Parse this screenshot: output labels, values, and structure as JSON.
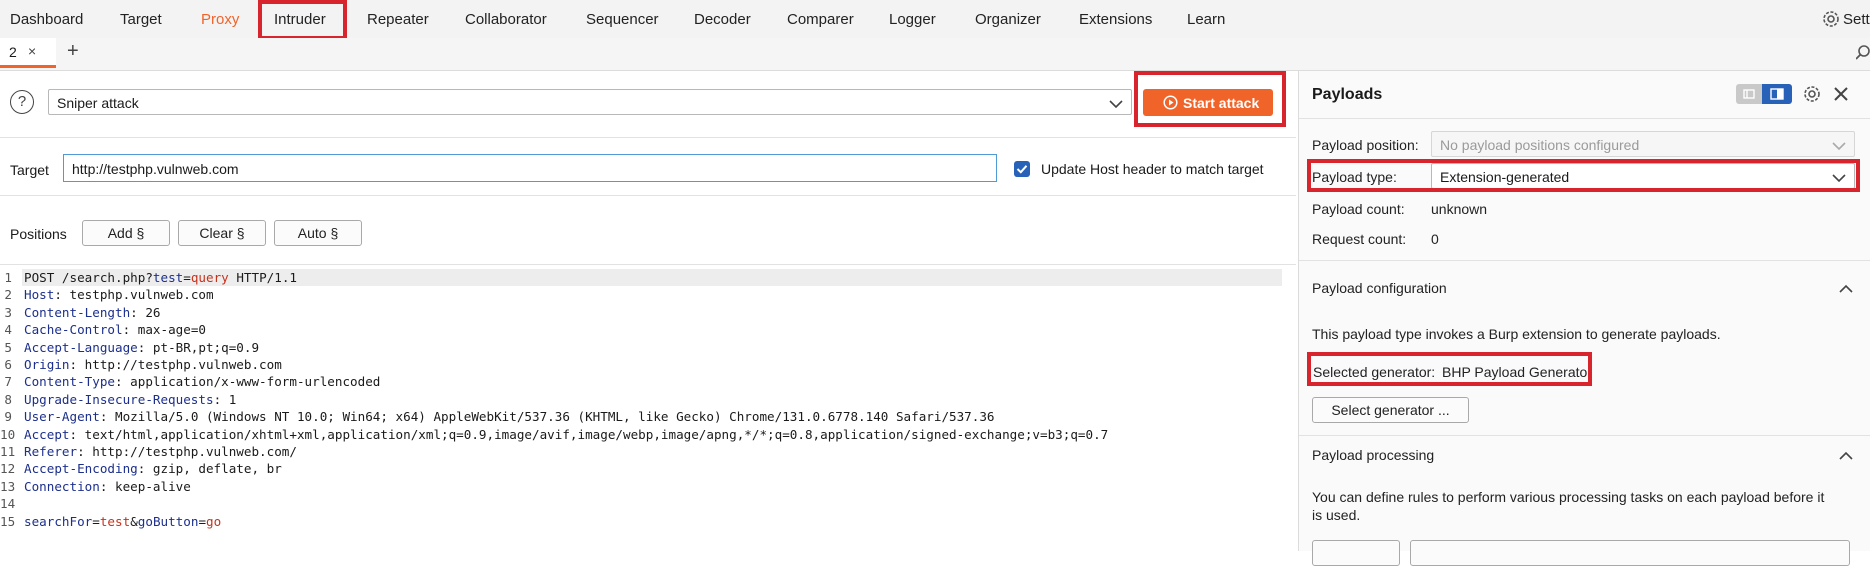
{
  "menu": {
    "items": [
      "Dashboard",
      "Target",
      "Proxy",
      "Intruder",
      "Repeater",
      "Collaborator",
      "Sequencer",
      "Decoder",
      "Comparer",
      "Logger",
      "Organizer",
      "Extensions",
      "Learn"
    ],
    "settings_label": "Setti",
    "active_color": "#f0642a"
  },
  "tabs": {
    "current": "2",
    "close": "×",
    "add": "+"
  },
  "attack": {
    "help": "?",
    "type": "Sniper attack",
    "start_label": "Start attack",
    "start_color": "#f0642a"
  },
  "target": {
    "label": "Target",
    "value": "http://testphp.vulnweb.com",
    "update_host_label": "Update Host header to match target",
    "update_host_checked": true
  },
  "positions": {
    "label": "Positions",
    "buttons": [
      "Add §",
      "Clear §",
      "Auto §"
    ]
  },
  "request": {
    "lines": [
      {
        "n": "1",
        "parts": [
          [
            "v",
            "POST /search.php?"
          ],
          [
            "k",
            "test"
          ],
          [
            "v",
            "="
          ],
          [
            "p",
            "query"
          ],
          [
            "v",
            " HTTP/1.1"
          ]
        ]
      },
      {
        "n": "2",
        "parts": [
          [
            "k",
            "Host"
          ],
          [
            "v",
            ": testphp.vulnweb.com"
          ]
        ]
      },
      {
        "n": "3",
        "parts": [
          [
            "k",
            "Content-Length"
          ],
          [
            "v",
            ": 26"
          ]
        ]
      },
      {
        "n": "4",
        "parts": [
          [
            "k",
            "Cache-Control"
          ],
          [
            "v",
            ": max-age=0"
          ]
        ]
      },
      {
        "n": "5",
        "parts": [
          [
            "k",
            "Accept-Language"
          ],
          [
            "v",
            ": pt-BR,pt;q=0.9"
          ]
        ]
      },
      {
        "n": "6",
        "parts": [
          [
            "k",
            "Origin"
          ],
          [
            "v",
            ": http://testphp.vulnweb.com"
          ]
        ]
      },
      {
        "n": "7",
        "parts": [
          [
            "k",
            "Content-Type"
          ],
          [
            "v",
            ": application/x-www-form-urlencoded"
          ]
        ]
      },
      {
        "n": "8",
        "parts": [
          [
            "k",
            "Upgrade-Insecure-Requests"
          ],
          [
            "v",
            ": 1"
          ]
        ]
      },
      {
        "n": "9",
        "parts": [
          [
            "k",
            "User-Agent"
          ],
          [
            "v",
            ": Mozilla/5.0 (Windows NT 10.0; Win64; x64) AppleWebKit/537.36 (KHTML, like Gecko) Chrome/131.0.6778.140 Safari/537.36"
          ]
        ]
      },
      {
        "n": "10",
        "parts": [
          [
            "k",
            "Accept"
          ],
          [
            "v",
            ": text/html,application/xhtml+xml,application/xml;q=0.9,image/avif,image/webp,image/apng,*/*;q=0.8,application/signed-exchange;v=b3;q=0.7"
          ]
        ]
      },
      {
        "n": "11",
        "parts": [
          [
            "k",
            "Referer"
          ],
          [
            "v",
            ": http://testphp.vulnweb.com/"
          ]
        ]
      },
      {
        "n": "12",
        "parts": [
          [
            "k",
            "Accept-Encoding"
          ],
          [
            "v",
            ": gzip, deflate, br"
          ]
        ]
      },
      {
        "n": "13",
        "parts": [
          [
            "k",
            "Connection"
          ],
          [
            "v",
            ": keep-alive"
          ]
        ]
      },
      {
        "n": "14",
        "parts": []
      },
      {
        "n": "15",
        "parts": [
          [
            "k",
            "searchFor"
          ],
          [
            "v",
            "="
          ],
          [
            "p",
            "test"
          ],
          [
            "v",
            "&"
          ],
          [
            "k",
            "goButton"
          ],
          [
            "v",
            "="
          ],
          [
            "p",
            "go"
          ]
        ]
      }
    ]
  },
  "payloads": {
    "title": "Payloads",
    "position_label": "Payload position:",
    "position_value": "No payload positions configured",
    "type_label": "Payload type:",
    "type_value": "Extension-generated",
    "count_label": "Payload count:",
    "count_value": "unknown",
    "request_count_label": "Request count:",
    "request_count_value": "0",
    "config_title": "Payload configuration",
    "config_desc": "This payload type invokes a Burp extension to generate payloads.",
    "generator_label": "Selected generator:",
    "generator_value": "BHP Payload Generator",
    "select_generator_label": "Select generator ...",
    "processing_title": "Payload processing",
    "processing_desc_1": "You can define rules to perform various processing tasks on each payload before it",
    "processing_desc_2": "is used."
  },
  "highlight_color": "#d8252d"
}
